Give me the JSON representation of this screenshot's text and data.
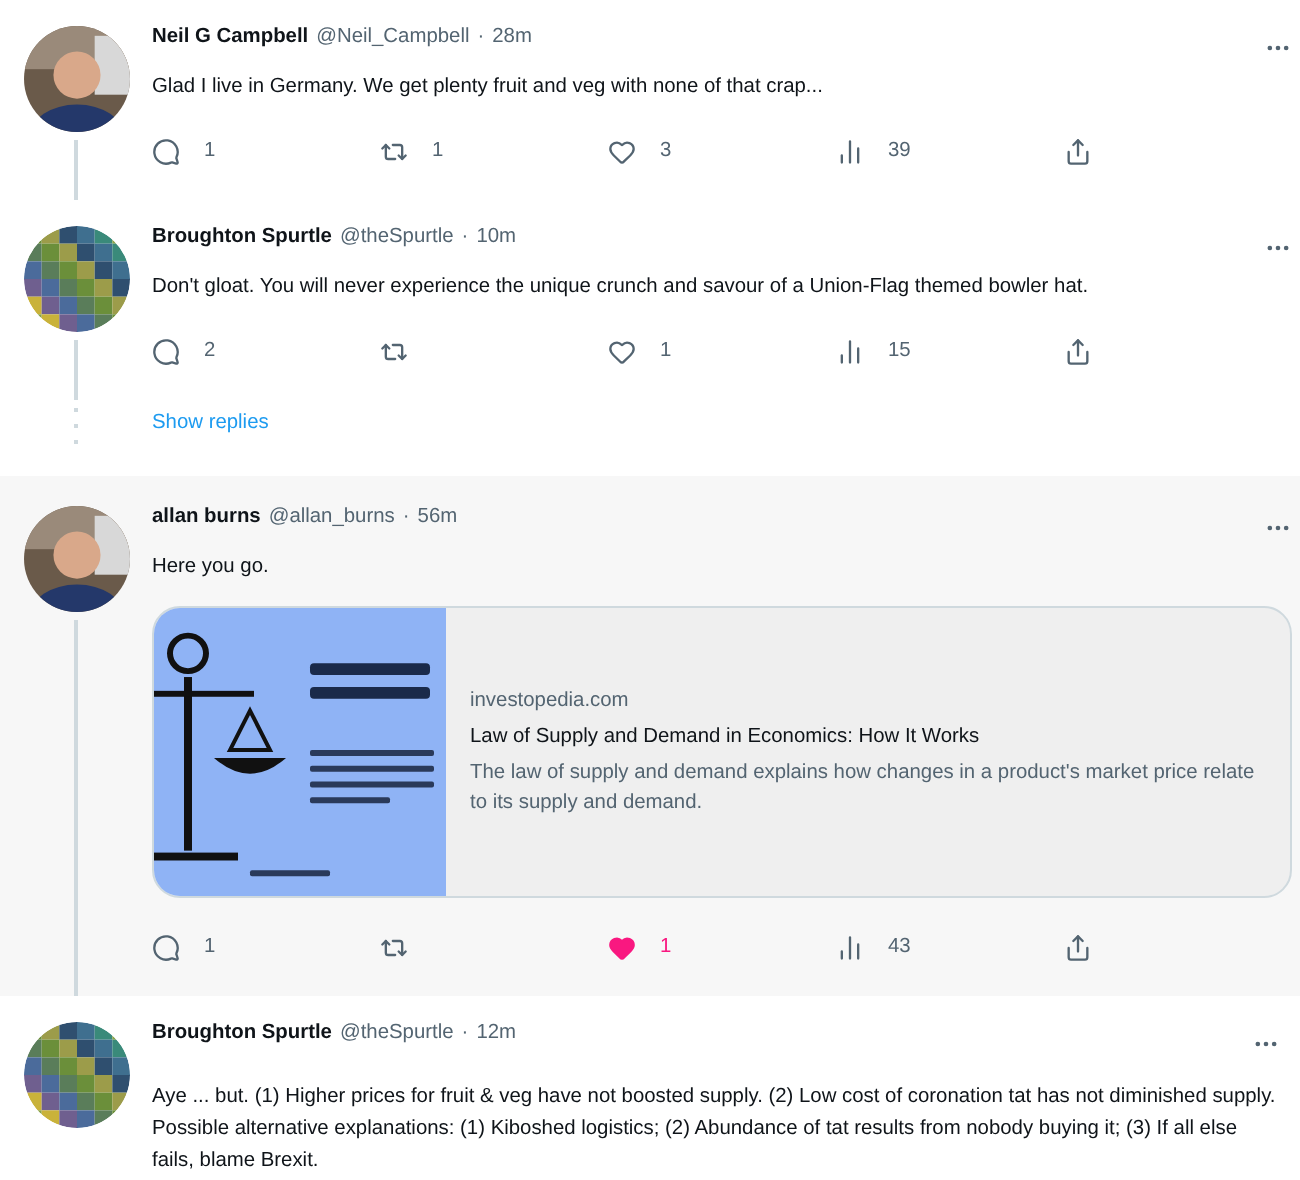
{
  "feed": [
    {
      "kind": "tweet",
      "name": "Neil G Campbell",
      "handle": "@Neil_Campbell",
      "separator": "·",
      "time": "28m",
      "highlighted": false,
      "connected_below": true,
      "text": "Glad I live in Germany. We get plenty fruit and veg with none of that crap...",
      "actions": {
        "replies": "1",
        "retweets": "1",
        "likes": "3",
        "liked": false,
        "views": "39"
      }
    },
    {
      "kind": "tweet",
      "name": "Broughton Spurtle",
      "handle": "@theSpurtle",
      "separator": "·",
      "time": "10m",
      "highlighted": false,
      "connected_below": true,
      "text": "Don't gloat. You will never experience the unique crunch and savour of a Union-Flag themed bowler hat.",
      "actions": {
        "replies": "2",
        "likes": "1",
        "liked": false,
        "views": "15"
      }
    },
    {
      "kind": "show_replies",
      "label": "Show replies"
    },
    {
      "kind": "tweet",
      "name": "allan burns",
      "handle": "@allan_burns",
      "separator": "·",
      "time": "56m",
      "highlighted": true,
      "connected_below": true,
      "text": "Here you go.",
      "card": {
        "domain": "investopedia.com",
        "title": "Law of Supply and Demand in Economics: How It Works",
        "description": "The law of supply and demand explains how changes in a product's market price relate to its supply and demand."
      },
      "actions": {
        "replies": "1",
        "likes": "1",
        "liked": true,
        "views": "43"
      }
    },
    {
      "kind": "tweet",
      "name": "Broughton Spurtle",
      "handle": "@theSpurtle",
      "separator": "·",
      "time": "12m",
      "highlighted": false,
      "connected_below": false,
      "text": "Aye ... but. (1) Higher prices for fruit & veg have not boosted supply. (2) Low cost of coronation tat has not diminished supply. Possible alternative explanations:  (1) Kiboshed logistics; (2) Abundance of tat results from nobody buying it; (3) If all else fails, blame Brexit."
    }
  ]
}
